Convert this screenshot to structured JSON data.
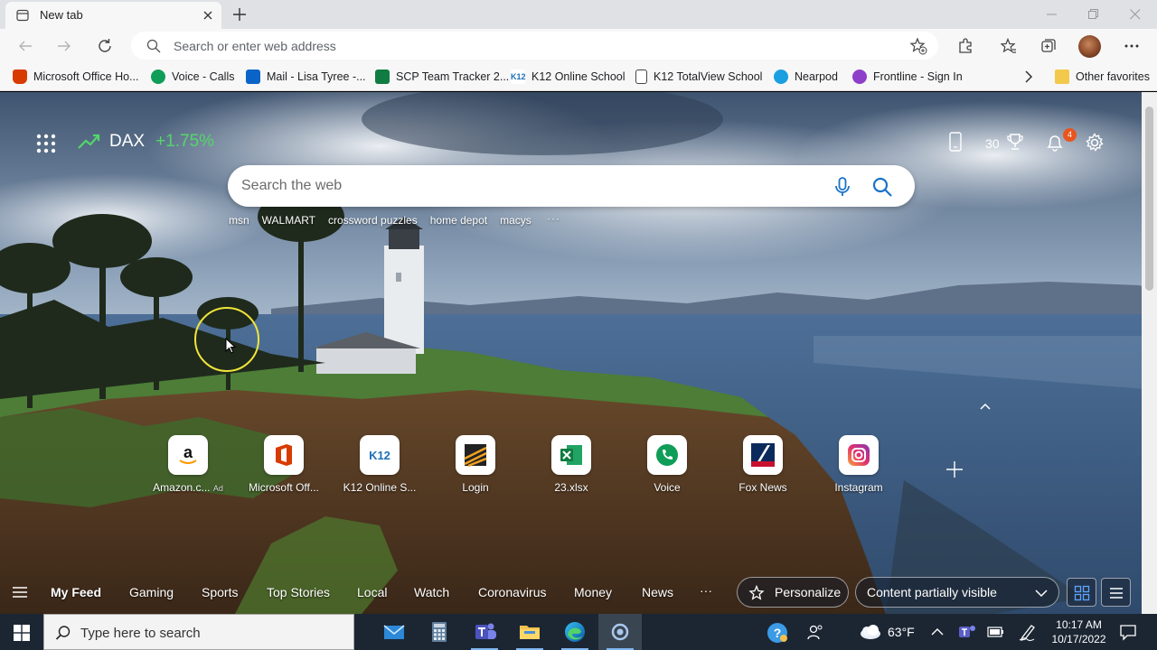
{
  "browser": {
    "tab": {
      "title": "New tab"
    },
    "address_bar": {
      "placeholder": "Search or enter web address",
      "value": ""
    },
    "favorites": [
      {
        "label": "Microsoft Office Ho...",
        "icon": "office-icon"
      },
      {
        "label": "Voice - Calls",
        "icon": "voice-icon"
      },
      {
        "label": "Mail - Lisa Tyree -...",
        "icon": "outlook-icon"
      },
      {
        "label": "SCP Team Tracker 2...",
        "icon": "excel-icon"
      },
      {
        "label": "K12 Online School",
        "icon": "k12-icon"
      },
      {
        "label": "K12 TotalView School",
        "icon": "page-icon"
      },
      {
        "label": "Nearpod",
        "icon": "nearpod-icon"
      },
      {
        "label": "Frontline - Sign In",
        "icon": "frontline-icon"
      }
    ],
    "other_favorites": "Other favorites"
  },
  "ntp": {
    "ticker": {
      "name": "DAX",
      "change": "+1.75%"
    },
    "rewards_points": "30",
    "notification_count": "4",
    "search": {
      "placeholder": "Search the web"
    },
    "trending": [
      "msn",
      "WALMART",
      "crossword puzzles",
      "home depot",
      "macys"
    ],
    "trending_more": "···",
    "quick_links": [
      {
        "label": "Amazon.c...",
        "ad": "Ad",
        "icon": "amazon-icon"
      },
      {
        "label": "Microsoft Off...",
        "icon": "office-icon"
      },
      {
        "label": "K12 Online S...",
        "icon": "k12-icon"
      },
      {
        "label": "Login",
        "icon": "login-icon"
      },
      {
        "label": "23.xlsx",
        "icon": "excel-icon"
      },
      {
        "label": "Voice",
        "icon": "voice-icon"
      },
      {
        "label": "Fox News",
        "icon": "fox-news-icon"
      },
      {
        "label": "Instagram",
        "icon": "instagram-icon"
      }
    ],
    "feed_nav": {
      "items": [
        "My Feed",
        "Gaming",
        "Sports",
        "Top Stories",
        "Local",
        "Watch",
        "Coronavirus",
        "Money",
        "News"
      ],
      "more": "···",
      "personalize": "Personalize",
      "content_visibility": "Content partially visible"
    }
  },
  "taskbar": {
    "search_placeholder": "Type here to search",
    "weather": {
      "temp": "63°F"
    },
    "time": "10:17 AM",
    "date": "10/17/2022"
  },
  "colors": {
    "accent_green": "#54d66a",
    "badge_orange": "#e8551d",
    "taskbar": "#1c2633"
  }
}
